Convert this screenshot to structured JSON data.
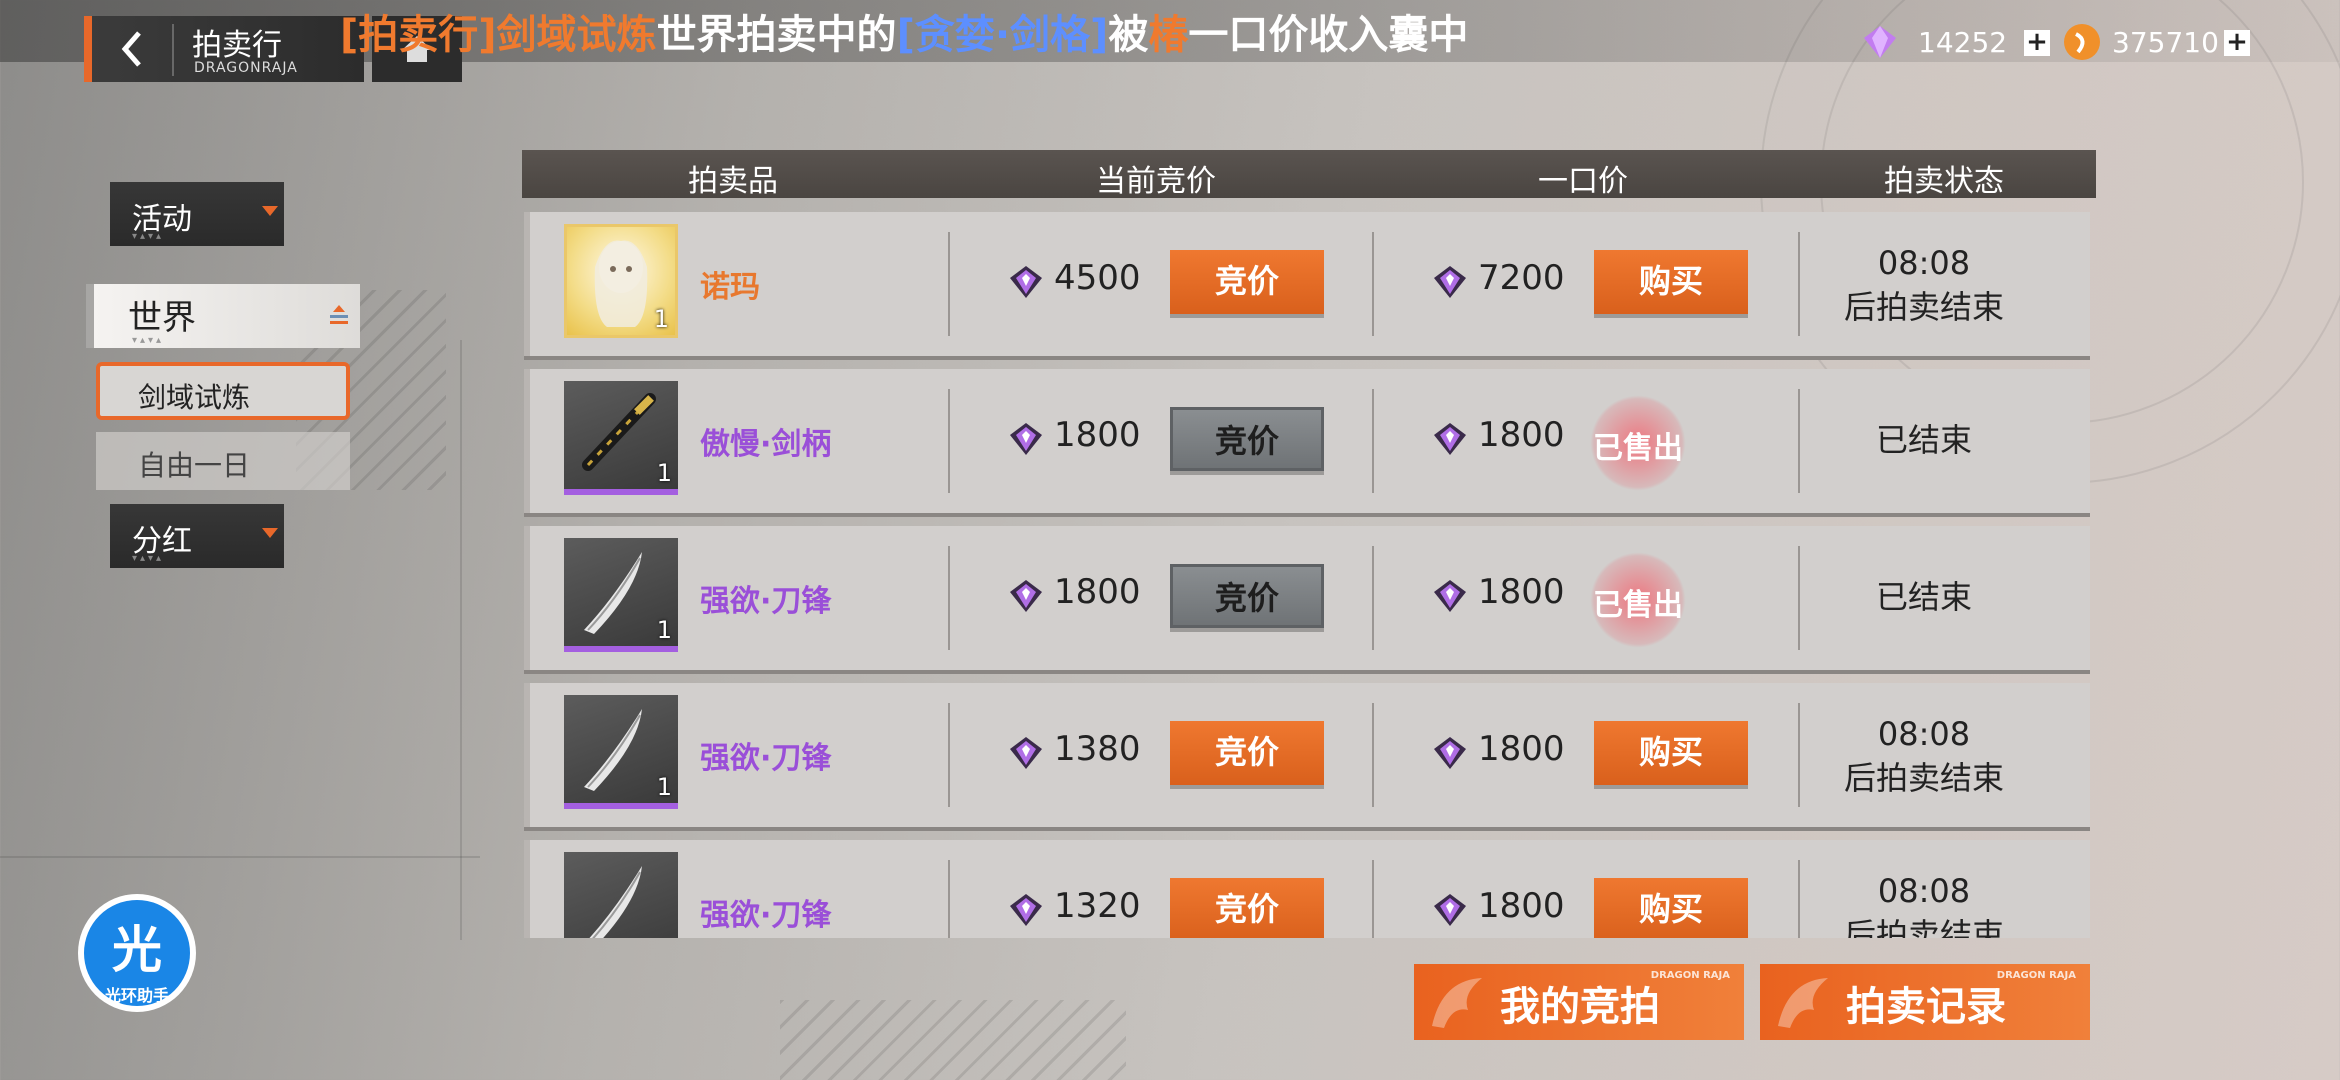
{
  "header": {
    "title": "拍卖行",
    "subtitle": "DRAGONRAJA",
    "ticker": [
      {
        "text": "[拍卖行]剑域试炼",
        "color": "orange"
      },
      {
        "text": "世界拍卖中的",
        "color": "white"
      },
      {
        "text": "[贪婪·剑格]",
        "color": "blue"
      },
      {
        "text": "被",
        "color": "white"
      },
      {
        "text": "椿",
        "color": "orange"
      },
      {
        "text": "一口价收入囊中",
        "color": "white"
      }
    ],
    "gem_amount": "14252",
    "coin_amount": "375710",
    "plus": "+"
  },
  "sidebar": {
    "activity": "活动",
    "world": "世界",
    "sub_items": [
      "剑域试炼",
      "自由一日"
    ],
    "dividend": "分红"
  },
  "table": {
    "headers": [
      "拍卖品",
      "当前竞价",
      "一口价",
      "拍卖状态"
    ],
    "rows": [
      {
        "name": "诺玛",
        "name_color": "#e8782e",
        "thumb": "gold",
        "count": "1",
        "bid": "4500",
        "bid_label": "竞价",
        "bid_active": true,
        "buyout": "7200",
        "buy_label": "购买",
        "sold": false,
        "status_line1": "08:08",
        "status_line2": "后拍卖结束"
      },
      {
        "name": "傲慢·剑柄",
        "name_color": "#9a4fd8",
        "thumb": "purple",
        "count": "1",
        "bid": "1800",
        "bid_label": "竞价",
        "bid_active": false,
        "buyout": "1800",
        "buy_label": "已售出",
        "sold": true,
        "status_line1": "已结束",
        "status_line2": ""
      },
      {
        "name": "强欲·刀锋",
        "name_color": "#9a4fd8",
        "thumb": "purple",
        "count": "1",
        "bid": "1800",
        "bid_label": "竞价",
        "bid_active": false,
        "buyout": "1800",
        "buy_label": "已售出",
        "sold": true,
        "status_line1": "已结束",
        "status_line2": ""
      },
      {
        "name": "强欲·刀锋",
        "name_color": "#9a4fd8",
        "thumb": "purple",
        "count": "1",
        "bid": "1380",
        "bid_label": "竞价",
        "bid_active": true,
        "buyout": "1800",
        "buy_label": "购买",
        "sold": false,
        "status_line1": "08:08",
        "status_line2": "后拍卖结束"
      },
      {
        "name": "强欲·刀锋",
        "name_color": "#9a4fd8",
        "thumb": "purple",
        "count": "",
        "bid": "1320",
        "bid_label": "竞价",
        "bid_active": true,
        "buyout": "1800",
        "buy_label": "购买",
        "sold": false,
        "status_line1": "08:08",
        "status_line2": "后拍卖结束"
      }
    ]
  },
  "footer": {
    "my_bids": "我的竞拍",
    "auction_records": "拍卖记录",
    "tag": "DRAGON RAJA"
  },
  "helper": {
    "glyph": "光",
    "label": "光环助手"
  },
  "colors": {
    "accent": "#e8682a",
    "gem": "#b06ee6",
    "coin": "#f0902a"
  }
}
